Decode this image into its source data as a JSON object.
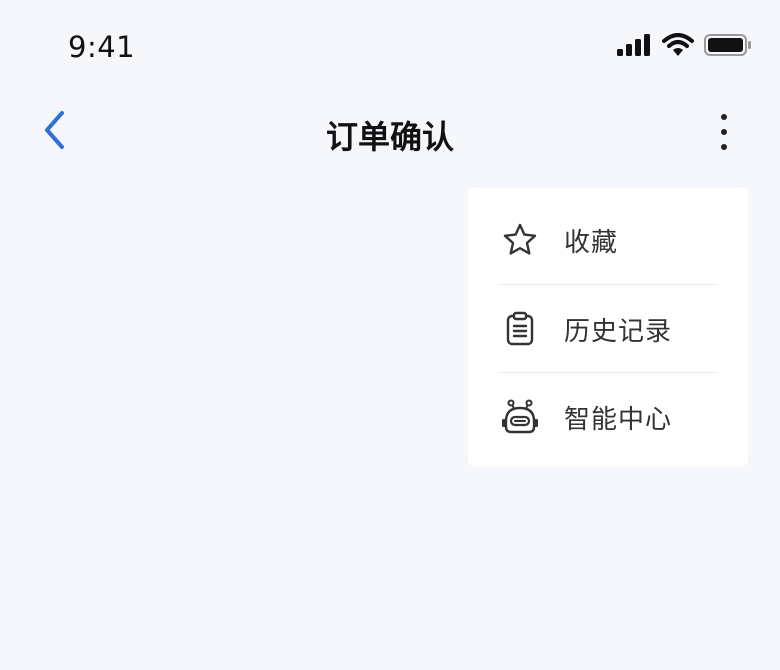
{
  "status_bar": {
    "time": "9:41"
  },
  "nav": {
    "title": "订单确认"
  },
  "menu": {
    "items": [
      {
        "label": "收藏",
        "icon": "star-icon"
      },
      {
        "label": "历史记录",
        "icon": "clipboard-icon"
      },
      {
        "label": "智能中心",
        "icon": "robot-icon"
      }
    ]
  },
  "colors": {
    "background": "#f5f7fd",
    "accent": "#2f6fd6",
    "menu_bg": "#ffffff"
  }
}
